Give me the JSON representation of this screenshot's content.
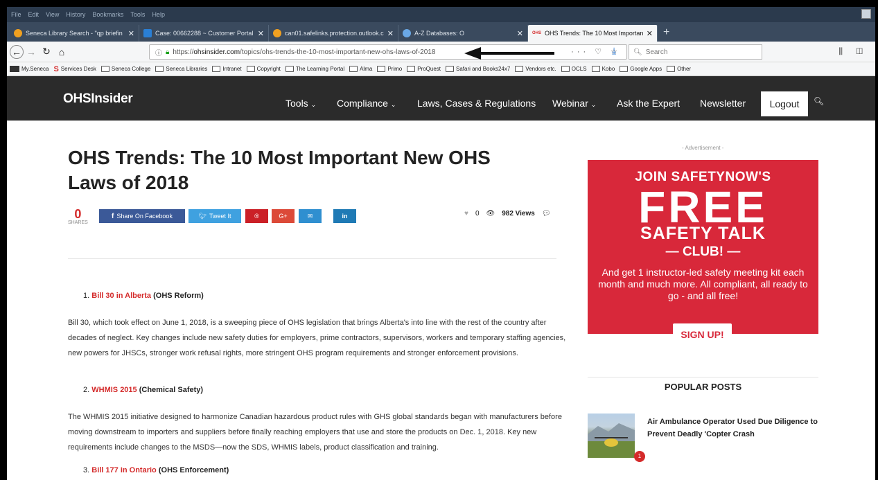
{
  "browser": {
    "menu": [
      "File",
      "Edit",
      "View",
      "History",
      "Bookmarks",
      "Tools",
      "Help"
    ],
    "tabs": [
      {
        "label": "Seneca Library Search - \"qp briefin",
        "icon_color": "#f0a020"
      },
      {
        "label": "Case: 00662288 ~ Customer Portal",
        "icon_color": "#2a7fd5"
      },
      {
        "label": "can01.safelinks.protection.outlook.c",
        "icon_color": "#f0a020"
      },
      {
        "label": "A-Z Databases: O",
        "icon_color": "#6aa8e6"
      },
      {
        "label": "OHS Trends: The 10 Most Importan",
        "icon_color": "#d42a2a",
        "favicon_text": "OHS"
      }
    ],
    "url_prefix": "https://",
    "url_domain": "ohsinsider.com",
    "url_path": "/topics/ohs-trends-the-10-most-important-new-ohs-laws-of-2018",
    "search_placeholder": "Search",
    "bookmarks": [
      "My.Seneca",
      "Services Desk",
      "Seneca College",
      "Seneca Libraries",
      "Intranet",
      "Copyright",
      "The Learning Portal",
      "Alma",
      "Primo",
      "ProQuest",
      "Safari and Books24x7",
      "Vendors etc.",
      "OCLS",
      "Kobo",
      "Google Apps",
      "Other"
    ]
  },
  "site": {
    "logo": "OHSInsider",
    "nav": {
      "tools": "Tools",
      "compliance": "Compliance",
      "laws": "Laws, Cases & Regulations",
      "webinar": "Webinar",
      "ask": "Ask the Expert",
      "newsletter": "Newsletter",
      "logout": "Logout"
    }
  },
  "article": {
    "title": "OHS Trends: The 10 Most Important New OHS Laws of 2018",
    "shares_count": "0",
    "shares_label": "SHARES",
    "share_buttons": {
      "facebook": "Share On Facebook",
      "twitter": "Tweet It",
      "pinterest": "®",
      "googleplus": "G+",
      "email": "✉",
      "linkedin": "in"
    },
    "likes": "0",
    "views": "982 Views",
    "items": [
      {
        "num": "1.",
        "link": "Bill 30 in Alberta",
        "tag": "(OHS Reform)",
        "text": "Bill 30, which took effect on June 1, 2018, is a sweeping piece of OHS legislation that brings Alberta's into line with the rest of the country after decades of neglect. Key changes include new safety duties for employers, prime contractors, supervisors, workers and temporary staffing agencies, new powers for JHSCs, stronger work refusal rights, more stringent OHS program requirements and stronger enforcement provisions."
      },
      {
        "num": "2.",
        "link": "WHMIS 2015",
        "tag": "(Chemical Safety)",
        "text": "The WHMIS 2015 initiative designed to harmonize Canadian hazardous product rules with GHS global standards began with manufacturers before moving downstream to importers and suppliers before finally reaching employers that use and store the products on Dec. 1, 2018. Key new requirements include changes to the MSDS—now the SDS, WHMIS labels, product classification and training."
      },
      {
        "num": "3.",
        "link": "Bill 177 in Ontario",
        "tag": "(OHS Enforcement)",
        "text": ""
      }
    ]
  },
  "sidebar": {
    "ad_label": "- Advertisement -",
    "ad": {
      "line1": "JOIN SAFETYNOW'S",
      "line2": "FREE",
      "line3": "SAFETY TALK",
      "line4": "— CLUB! —",
      "body": "And get 1 instructor-led safety meeting kit each month and much more. All compliant, all ready to go - and all free!",
      "button": "SIGN UP!"
    },
    "popular_heading": "POPULAR POSTS",
    "popular": [
      {
        "title": "Air Ambulance Operator Used Due Diligence to Prevent Deadly 'Copter Crash",
        "count": "1"
      }
    ]
  },
  "colors": {
    "accent_red": "#d42a2a",
    "nav_bg": "#2b2b2b",
    "ad_red": "#d8283a",
    "facebook": "#3b5998",
    "twitter": "#3fa1e0",
    "pinterest": "#cb2027",
    "googleplus": "#dc4a38",
    "email": "#2f8fd0",
    "linkedin": "#1f7ab5"
  }
}
